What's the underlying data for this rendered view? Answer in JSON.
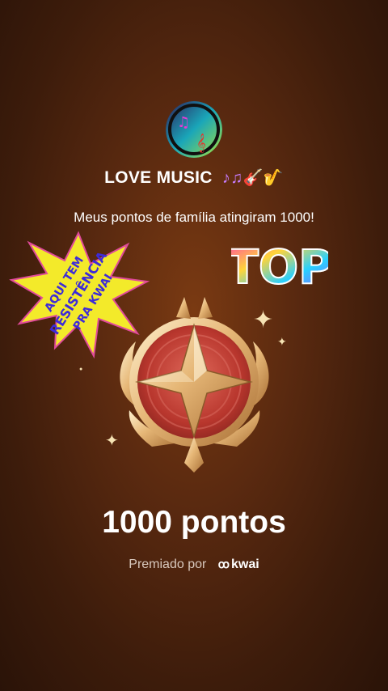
{
  "profile": {
    "name": "LOVE MUSIC",
    "name_emojis": "♪♫🎸🎷"
  },
  "message": "Meus pontos de família atingiram 1000!",
  "sticker_left_text": [
    "AQUI TEM",
    "RESISTÊNCIA",
    "PRA KWAI"
  ],
  "sticker_top_text": "TOP",
  "points_label": "1000 pontos",
  "award": {
    "prefix": "Premiado por",
    "brand": "kwai"
  },
  "colors": {
    "background": "#5b2a10",
    "gold": "#f2c98a",
    "badge_red": "#c4473a",
    "sticker_yellow": "#f3ea2a",
    "sticker_blue": "#3d2bd8"
  }
}
